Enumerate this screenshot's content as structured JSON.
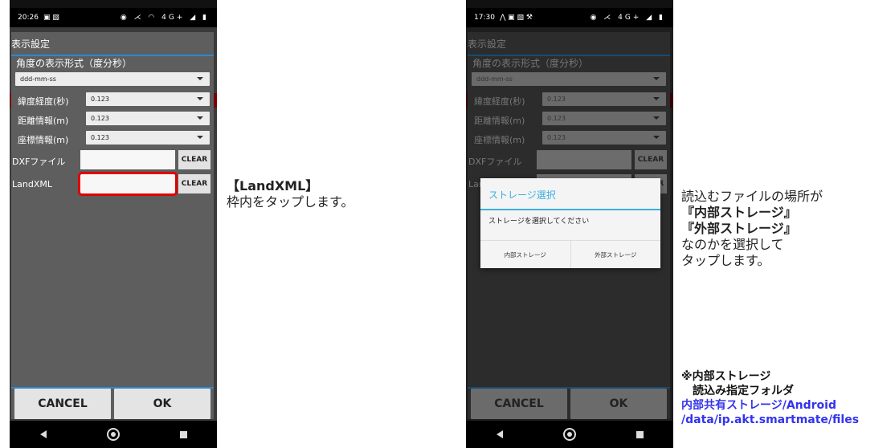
{
  "left_phone": {
    "status_time": "20:26",
    "status_right": "◉ ⋌ ◠ 4G+ ◢ ▮",
    "dialog_title": "表示設定",
    "angle_section_title": "角度の表示形式（度分秒）",
    "angle_format_value": "ddd-mm-ss",
    "rows": [
      {
        "label": "緯度経度(秒)",
        "value": "0.123"
      },
      {
        "label": "距離情報(m)",
        "value": "0.123"
      },
      {
        "label": "座標情報(m)",
        "value": "0.123"
      }
    ],
    "dxf_label": "DXFファイル",
    "dxf_value": "",
    "landxml_label": "LandXML",
    "landxml_value": "",
    "clear_label": "CLEAR",
    "cancel_label": "CANCEL",
    "ok_label": "OK"
  },
  "left_caption": {
    "title": "【LandXML】",
    "body": "枠内をタップします。"
  },
  "right_phone": {
    "status_time": "17:30",
    "status_right": "◉ ⋌ 4G+ ◢ ▮",
    "dialog_title": "表示設定",
    "angle_section_title": "角度の表示形式（度分秒）",
    "angle_format_value": "ddd-mm-ss",
    "rows": [
      {
        "label": "緯度経度(秒)",
        "value": "0.123"
      },
      {
        "label": "距離情報(m)",
        "value": "0.123"
      },
      {
        "label": "座標情報(m)",
        "value": "0.123"
      }
    ],
    "dxf_label": "DXFファイル",
    "landxml_label": "LandXML",
    "clear_label": "CLEAR",
    "cancel_label": "CANCEL",
    "ok_label": "OK",
    "modal": {
      "title": "ストレージ選択",
      "message": "ストレージを選択してください",
      "internal_label": "内部ストレージ",
      "external_label": "外部ストレージ",
      "accent": "#3ab0e0"
    }
  },
  "right_caption": {
    "line1": "読込むファイルの場所が",
    "line2": "『内部ストレージ』",
    "line3": "『外部ストレージ』",
    "line4": "なのかを選択して",
    "line5": "タップします。"
  },
  "note": {
    "line1": "※内部ストレージ",
    "line2": "　読込み指定フォルダ",
    "path1": "内部共有ストレージ/Android",
    "path2": "/data/ip.akt.smartmate/files",
    "path_color": "#3333ee"
  }
}
